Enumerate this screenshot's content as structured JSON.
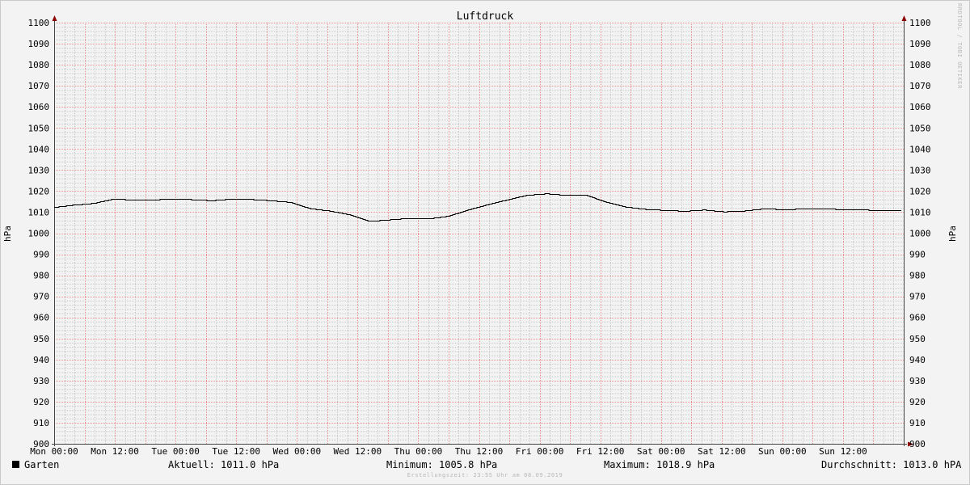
{
  "chart_data": {
    "type": "line",
    "title": "Luftdruck",
    "ylabel": "hPa",
    "ylabel_right": "hPa",
    "ylim": [
      900,
      1100
    ],
    "y_ticks": [
      "900",
      "910",
      "920",
      "930",
      "940",
      "950",
      "960",
      "970",
      "980",
      "990",
      "1000",
      "1010",
      "1020",
      "1030",
      "1040",
      "1050",
      "1060",
      "1070",
      "1080",
      "1090",
      "1100"
    ],
    "x_ticks": [
      "Mon 00:00",
      "Mon 12:00",
      "Tue 00:00",
      "Tue 12:00",
      "Wed 00:00",
      "Wed 12:00",
      "Thu 00:00",
      "Thu 12:00",
      "Fri 00:00",
      "Fri 12:00",
      "Sat 00:00",
      "Sat 12:00",
      "Sun 00:00",
      "Sun 12:00"
    ],
    "x_hours": [
      0,
      6,
      12,
      18,
      24,
      30,
      36,
      42,
      48,
      54,
      60,
      66,
      72,
      78,
      84,
      90,
      96,
      102,
      108,
      114,
      120,
      126,
      132,
      138,
      144,
      150,
      156,
      162,
      168
    ],
    "grid": true,
    "colors": {
      "line": "#000000",
      "major_grid": "#e58f8f",
      "minor_grid": "#c9c9c9",
      "axis": "#444444",
      "arrow": "#8b0000"
    },
    "series": [
      {
        "name": "Garten",
        "values": [
          1012.4,
          1013.5,
          1014.3,
          1016.3,
          1016.0,
          1015.9,
          1016.5,
          1016.1,
          1015.6,
          1016.4,
          1016.2,
          1015.6,
          1014.8,
          1011.8,
          1010.7,
          1008.9,
          1005.8,
          1006.5,
          1007.2,
          1007.0,
          1008.2,
          1011.2,
          1013.7,
          1016.0,
          1018.2,
          1018.9,
          1018.1,
          1018.2,
          1014.9,
          1012.6,
          1011.5,
          1011.0,
          1010.6,
          1011.2,
          1010.3,
          1010.7,
          1011.7,
          1011.4,
          1011.6,
          1011.9,
          1011.3,
          1011.2,
          1011.0,
          1011.0
        ]
      }
    ]
  },
  "legend": {
    "series_name": "Garten",
    "aktuell": "Aktuell: 1011.0 hPa",
    "minimum": "Minimum: 1005.8 hPa",
    "maximum": "Maximum: 1018.9 hPa",
    "durchschnitt": "Durchschnitt: 1013.0 hPA"
  },
  "footer": "Erstellungszeit: 23:55 Uhr am 08.09.2019",
  "watermark": "RRDTOOL / TOBI OETIKER"
}
